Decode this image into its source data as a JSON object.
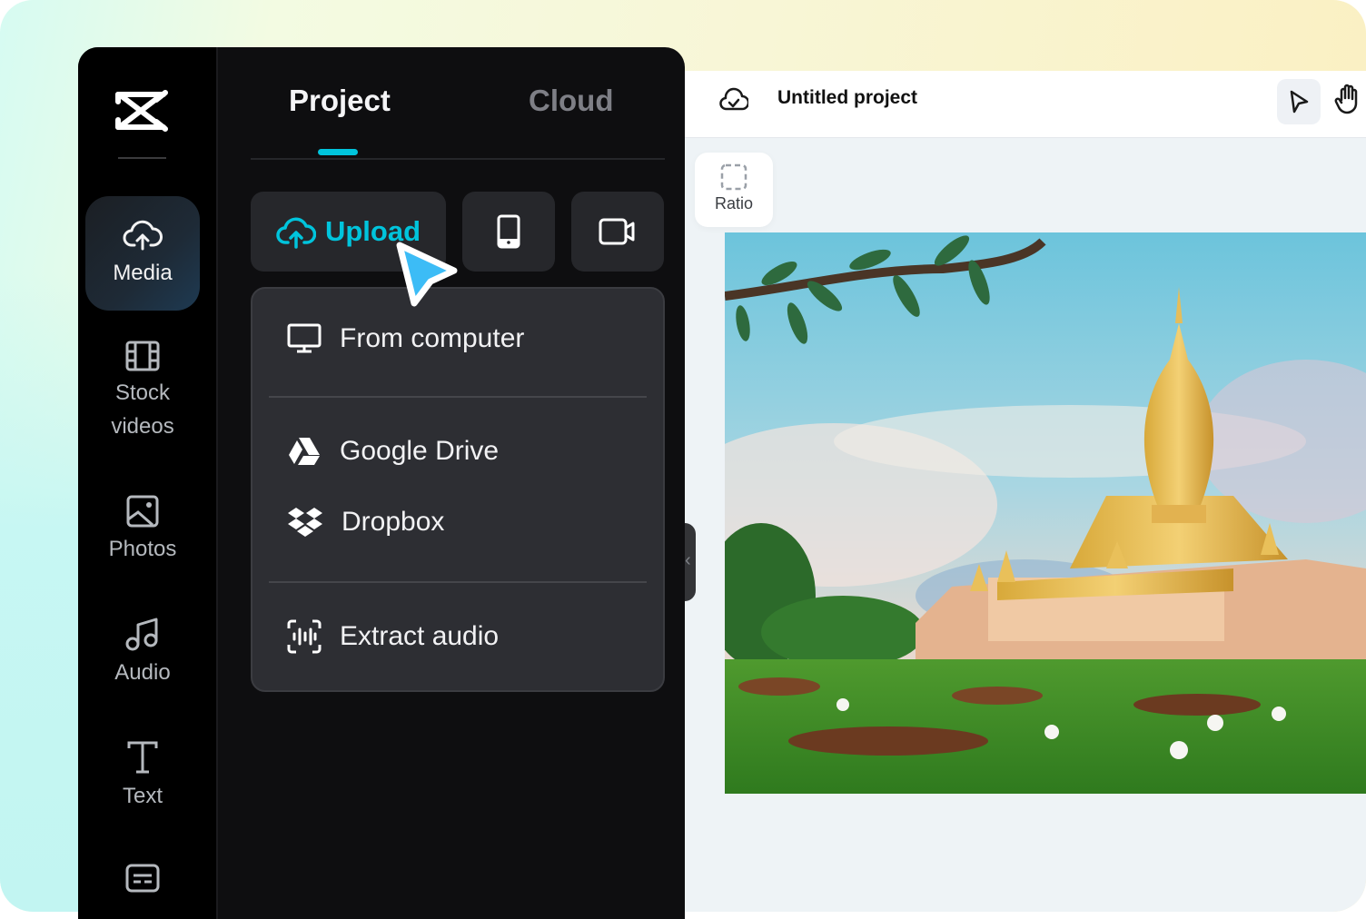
{
  "sidebar": {
    "logo": "capcut-logo",
    "items": [
      {
        "label": "Media",
        "icon": "cloud-upload-icon",
        "active": true
      },
      {
        "label": "Stock\nvideos",
        "line1": "Stock",
        "line2": "videos",
        "icon": "film-icon"
      },
      {
        "label": "Photos",
        "icon": "image-icon"
      },
      {
        "label": "Audio",
        "icon": "music-note-icon"
      },
      {
        "label": "Text",
        "icon": "text-icon"
      },
      {
        "label": "",
        "icon": "captions-icon"
      }
    ]
  },
  "panel": {
    "tabs": [
      {
        "label": "Project",
        "active": true
      },
      {
        "label": "Cloud",
        "active": false
      }
    ],
    "upload_label": "Upload",
    "phone_button": "phone-icon",
    "record_button": "video-camera-icon",
    "menu": {
      "items": [
        {
          "label": "From computer",
          "icon": "monitor-icon"
        },
        {
          "label": "Google Drive",
          "icon": "google-drive-icon"
        },
        {
          "label": "Dropbox",
          "icon": "dropbox-icon"
        },
        {
          "label": "Extract audio",
          "icon": "extract-audio-icon"
        }
      ]
    },
    "collapse_glyph": "‹"
  },
  "editor": {
    "project_title": "Untitled project",
    "ratio_label": "Ratio",
    "tools": [
      "select-pointer-icon",
      "hand-pan-icon"
    ],
    "canvas_image": "Golden Buddhist stupa temple with green lawn, fallen leaves and frangipani flowers under a blue sky"
  },
  "colors": {
    "accent": "#00c4dc",
    "cursor": "#3cbcf6",
    "sidebar_bg": "#000000",
    "panel_bg": "#0e0e10",
    "menu_bg": "#2d2e33",
    "canvas_bg": "#eef3f6"
  }
}
